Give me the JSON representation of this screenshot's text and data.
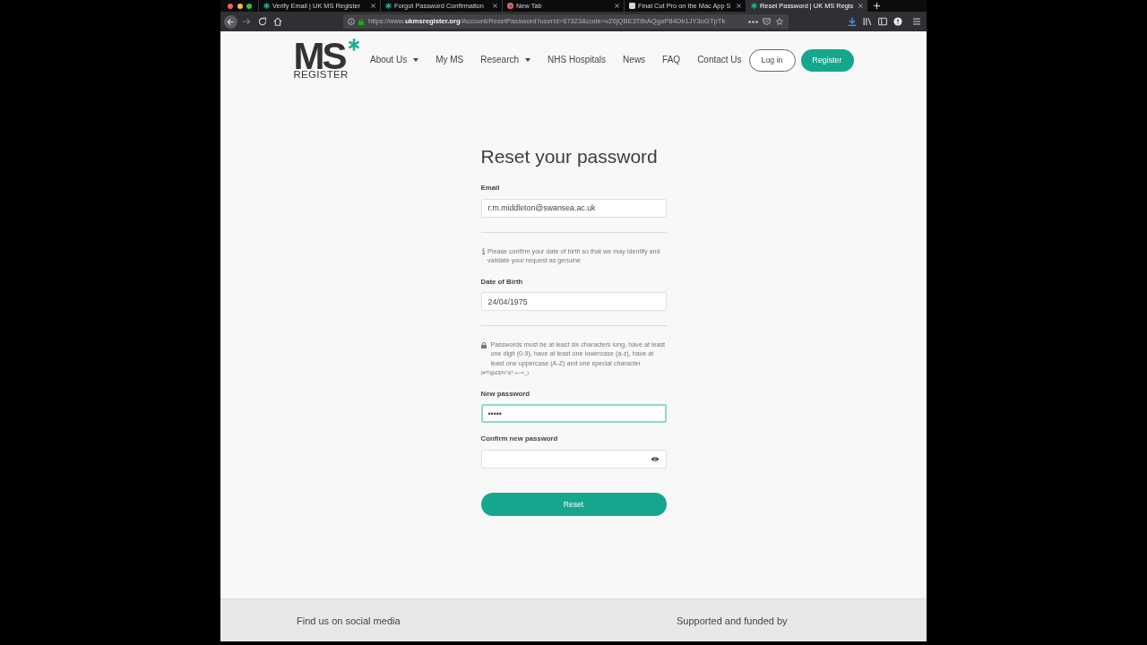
{
  "browser": {
    "tabs": [
      {
        "title": "Verify Email | UK MS Register",
        "kind": "site",
        "selected": false
      },
      {
        "title": "Forgot Password Confirmation",
        "kind": "site",
        "selected": false
      },
      {
        "title": "New Tab",
        "kind": "browser",
        "selected": false
      },
      {
        "title": "Final Cut Pro on the Mac App S",
        "kind": "store",
        "selected": false
      },
      {
        "title": "Reset Password | UK MS Regis",
        "kind": "site",
        "selected": true
      }
    ],
    "url": "https://www.**ukmsregister.org**/Account/ResetPassword?userId=67323&code=vZ6jQBE3TifxAQgaP84Db1JY3oGTpTk"
  },
  "header": {
    "logo": {
      "wordmark": "MS",
      "subtitle": "REGISTER"
    },
    "nav": [
      {
        "label": "About Us",
        "dropdown": true
      },
      {
        "label": "My MS",
        "dropdown": false
      },
      {
        "label": "Research",
        "dropdown": true
      },
      {
        "label": "NHS Hospitals",
        "dropdown": false
      },
      {
        "label": "News",
        "dropdown": false
      },
      {
        "label": "FAQ",
        "dropdown": false
      },
      {
        "label": "Contact Us",
        "dropdown": false
      }
    ],
    "login": "Log in",
    "register": "Register"
  },
  "form": {
    "title": "Reset your password",
    "email": {
      "label": "Email",
      "value": "r.m.middleton@swansea.ac.uk",
      "focused": false
    },
    "dob_notice": "Please confirm your date of birth so that we may identify and validate your request as genuine",
    "date_of_birth": {
      "label": "Date of Birth",
      "value": "24/04/1975",
      "focused": false
    },
    "password_rules": "Passwords must be at least six characters long, have at least one digit (0-9), have at least one lowercase (a-z), have at least one uppercase (A-Z) and one special character",
    "special_characters": "(#?!@£$%^&*-+~=_)",
    "new_password": {
      "label": "New password",
      "value": "•••••",
      "focused": true
    },
    "confirm_password": {
      "label": "Confirm new password",
      "focused": false,
      "reveal_toggle": true
    },
    "submit": "Reset"
  },
  "footer": {
    "social": "Find us on social media",
    "support": "Supported and funded by"
  }
}
